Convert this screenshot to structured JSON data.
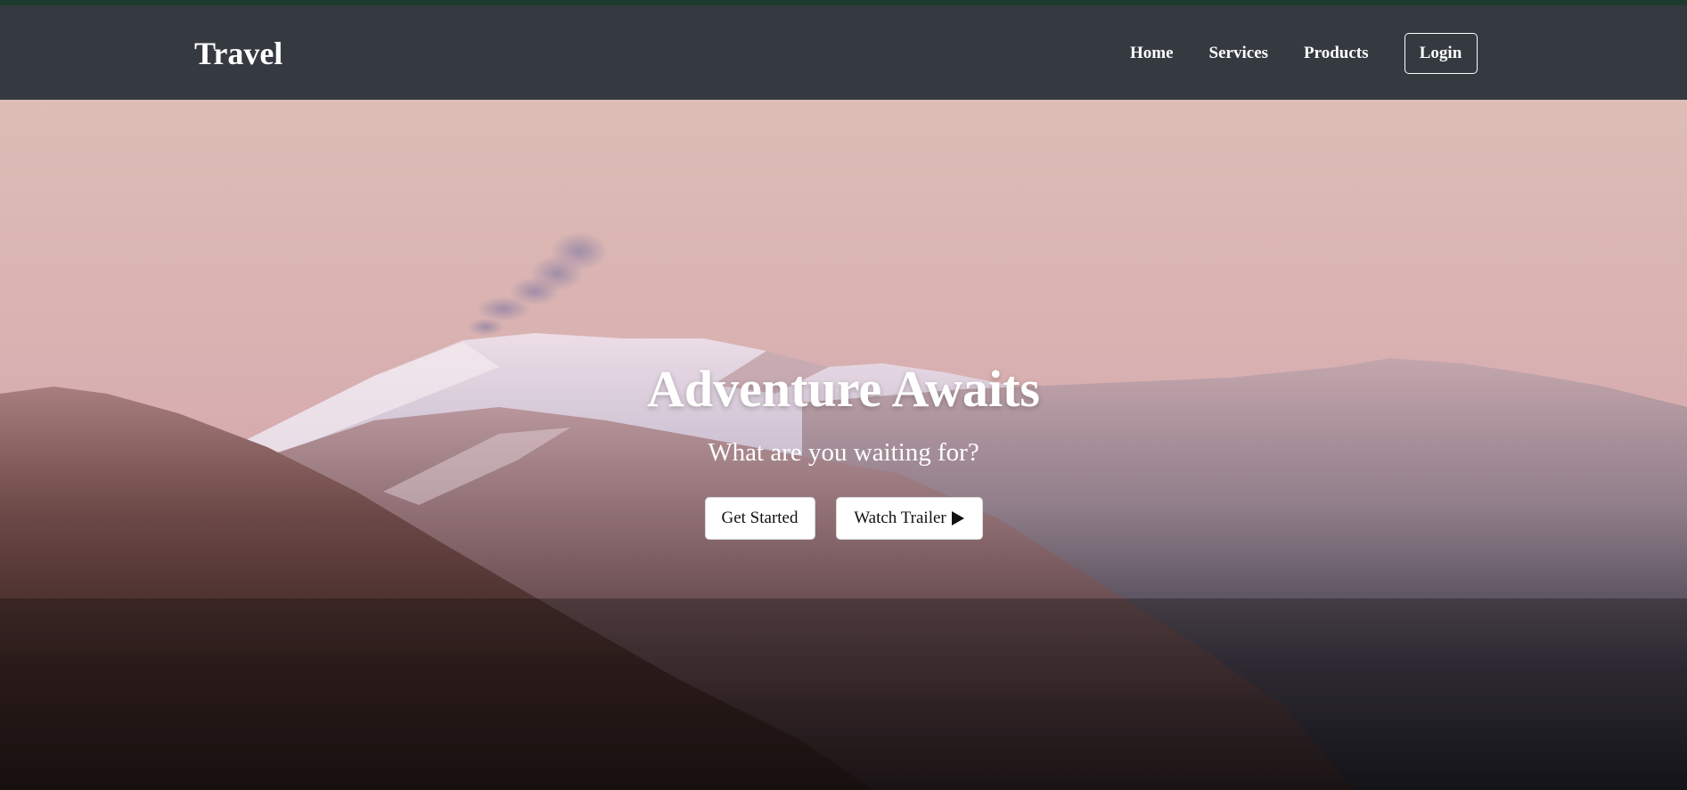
{
  "header": {
    "brand": "Travel",
    "nav": {
      "home": "Home",
      "services": "Services",
      "products": "Products"
    },
    "login_label": "Login"
  },
  "hero": {
    "title": "Adventure Awaits",
    "subtitle": "What are you waiting for?",
    "get_started_label": "Get Started",
    "watch_trailer_label": "Watch Trailer",
    "watch_trailer_icon": "play-icon",
    "background_image": "snowy-mountains-at-dusk"
  },
  "colors": {
    "navbar": "#343a40",
    "top_accent": "#1f3a2e",
    "button_bg": "#ffffff",
    "text_light": "#ffffff"
  }
}
